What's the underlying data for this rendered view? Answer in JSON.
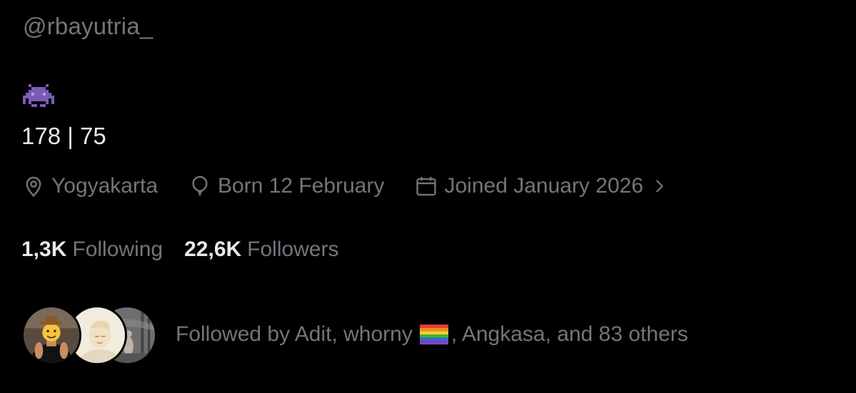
{
  "profile": {
    "handle": "@rbayutria_",
    "bio_emoji": "alien-monster-emoji",
    "bio_text": "178 | 75",
    "location": "Yogyakarta",
    "birthday": "Born 12 February",
    "joined": "Joined January 2026"
  },
  "stats": {
    "following_count": "1,3K",
    "following_label": "Following",
    "followers_count": "22,6K",
    "followers_label": "Followers"
  },
  "followed_by": {
    "prefix": "Followed by Adit, whorny",
    "suffix": ", Angkasa, and 83 others",
    "flag_emoji": "rainbow-flag-emoji"
  },
  "colors": {
    "background": "#000000",
    "primary_text": "#e7e9ea",
    "secondary_text": "#71767b",
    "emoji_purple": "#7b5bb8"
  }
}
